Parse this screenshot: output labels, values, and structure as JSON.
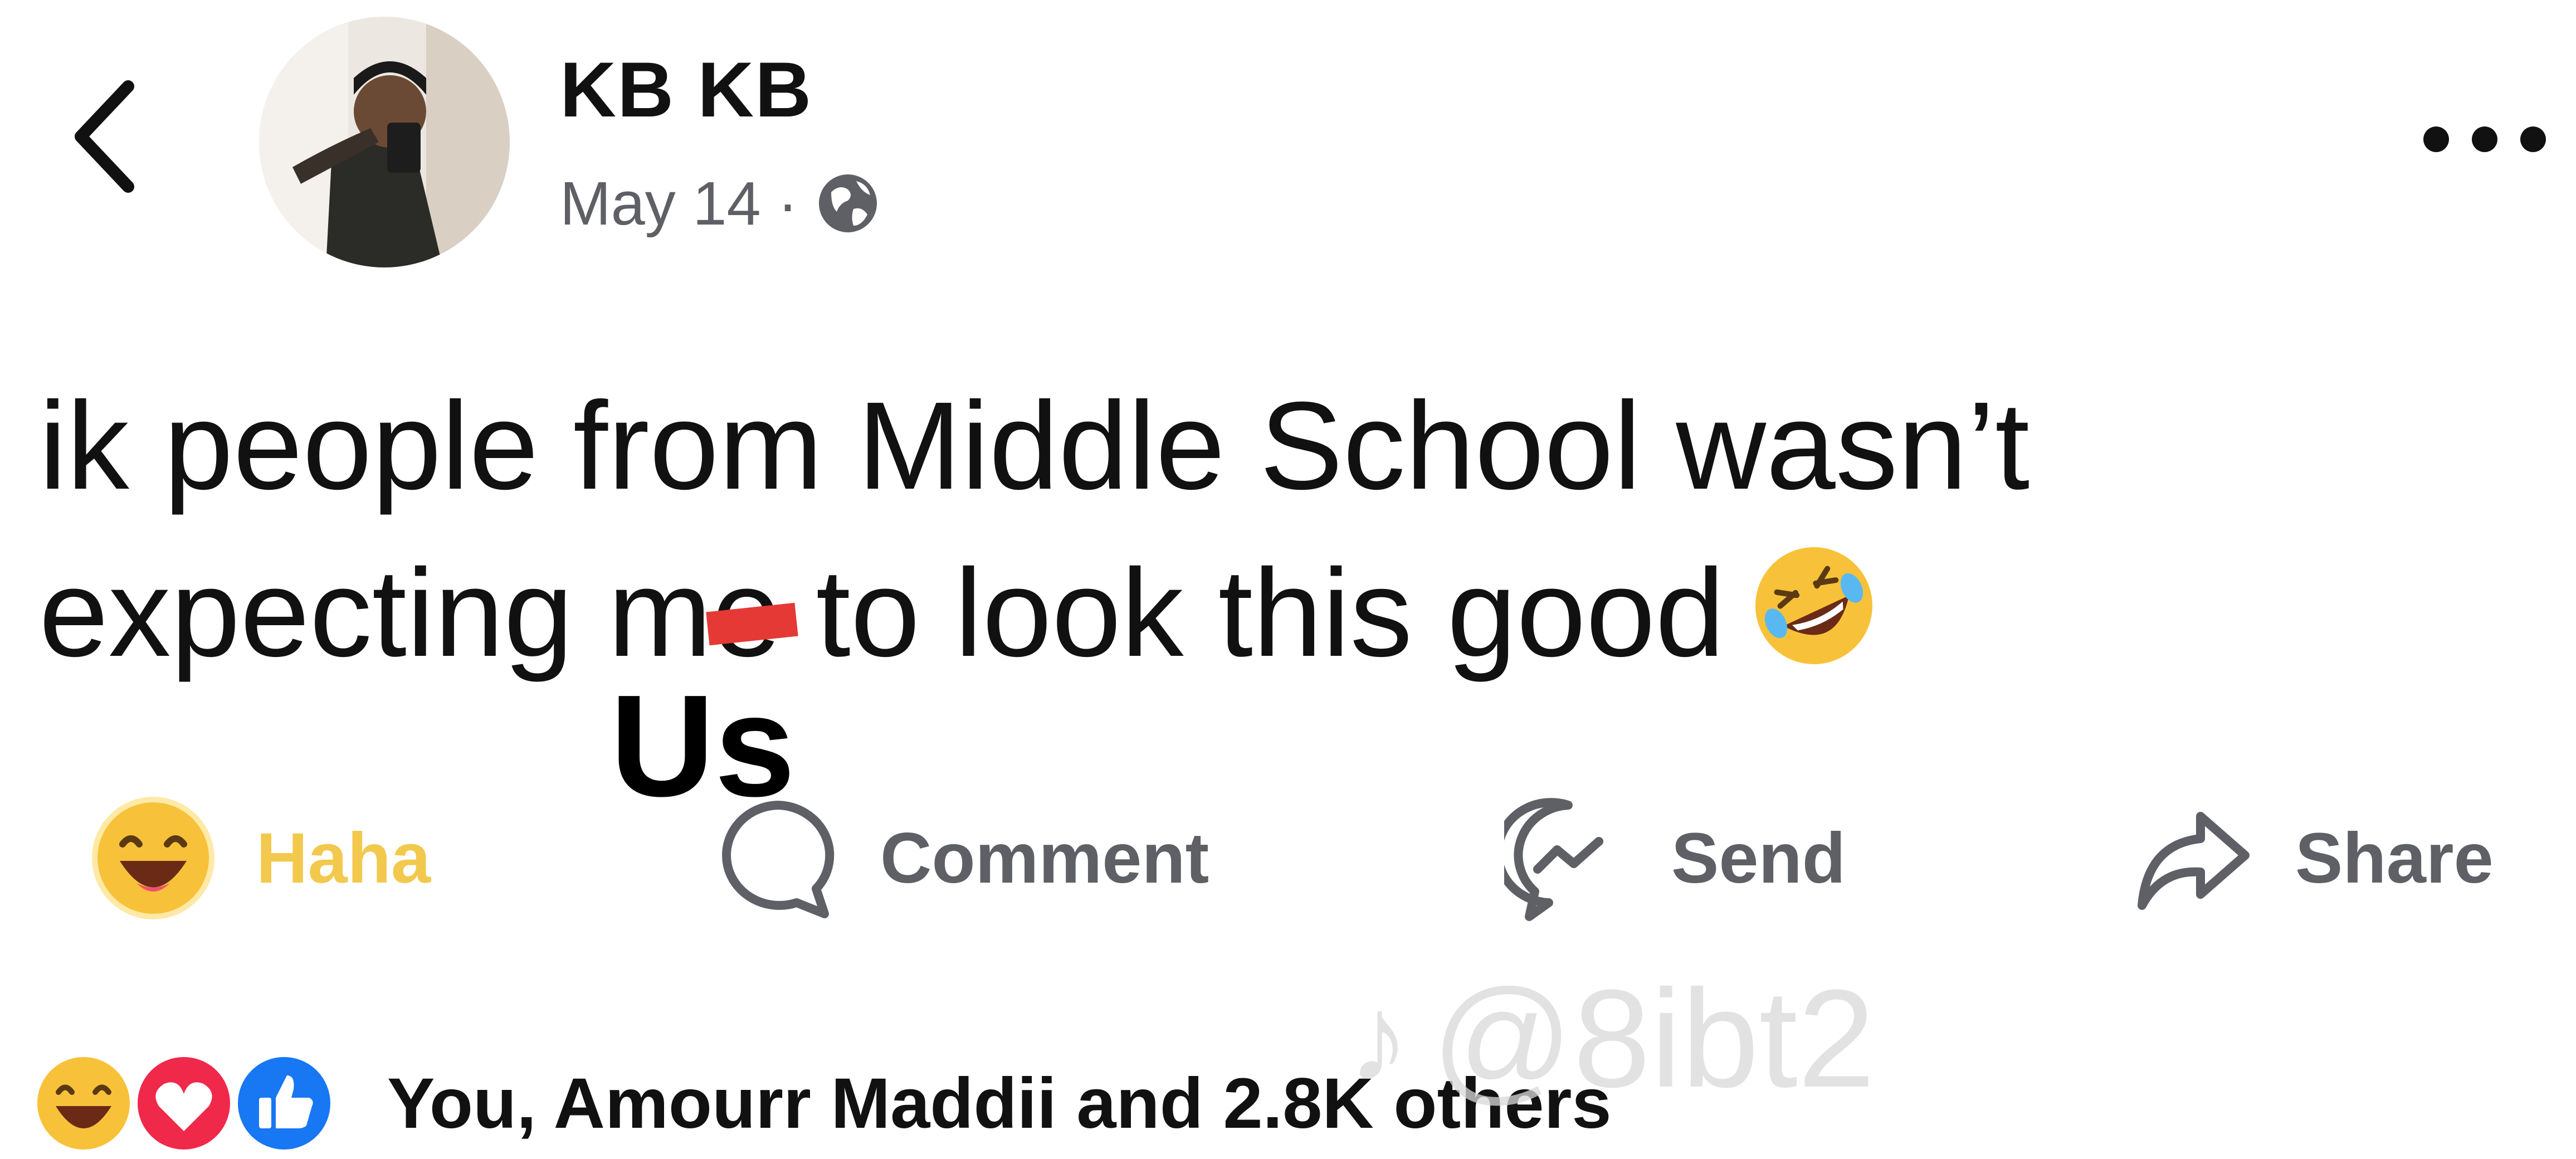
{
  "header": {
    "author_name": "KB KB",
    "post_date": "May 14",
    "date_separator": "·",
    "privacy_icon": "globe-icon",
    "back_icon": "chevron-left-icon",
    "more_icon": "more-horizontal-icon"
  },
  "post": {
    "line1": "ik people from Middle School wasn’t",
    "line2": "expecting me to look this good",
    "emoji": "rolling-on-floor-laughing-emoji",
    "edit_overlay": "Us"
  },
  "actions": {
    "haha_label": "Haha",
    "comment_label": "Comment",
    "send_label": "Send",
    "share_label": "Share"
  },
  "reactions": {
    "icons": [
      "haha-icon",
      "love-icon",
      "like-icon"
    ],
    "summary": "You, Amourr Maddii and 2.8K others"
  },
  "watermark": {
    "text": "@8ibt2",
    "icon": "tiktok-icon"
  },
  "colors": {
    "haha_yellow": "#f2c94c",
    "love_red": "#f0284a",
    "like_blue": "#1877f2",
    "edit_red": "#e53935"
  }
}
